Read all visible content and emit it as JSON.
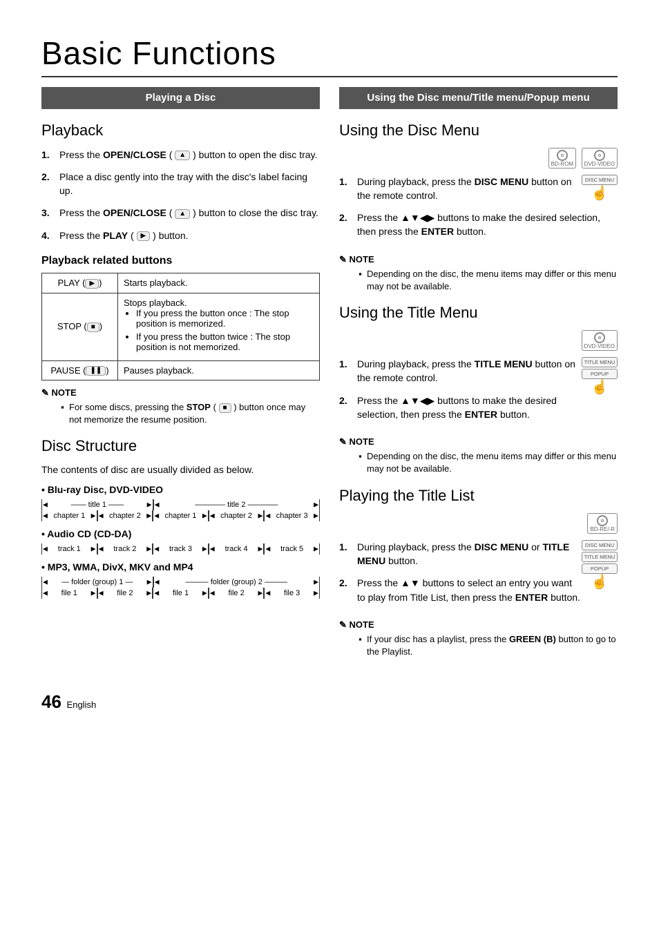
{
  "page": {
    "title": "Basic Functions",
    "number": "46",
    "lang": "English"
  },
  "left": {
    "band": "Playing a Disc",
    "playback_head": "Playback",
    "steps": [
      {
        "pre": "Press the ",
        "bold": "OPEN/CLOSE",
        "post_icon": "▲",
        "tail": " button to open the disc tray."
      },
      {
        "pre": "Place a disc gently into the tray with the disc's label facing up.",
        "bold": "",
        "post_icon": "",
        "tail": ""
      },
      {
        "pre": "Press the ",
        "bold": "OPEN/CLOSE",
        "post_icon": "▲",
        "tail": " button to close the disc tray."
      },
      {
        "pre": "Press the ",
        "bold": "PLAY",
        "post_icon": "▶",
        "tail": " button."
      }
    ],
    "related_head": "Playback related buttons",
    "table": [
      {
        "name": "PLAY",
        "icon": "▶",
        "desc": "Starts playback.",
        "bullets": []
      },
      {
        "name": "STOP",
        "icon": "■",
        "desc": "Stops playback.",
        "bullets": [
          "If you press the button once : The stop position is memorized.",
          "If you press the button twice : The stop position is not memorized."
        ]
      },
      {
        "name": "PAUSE",
        "icon": "❚❚",
        "desc": "Pauses playback.",
        "bullets": []
      }
    ],
    "note_label": "NOTE",
    "note_items": [
      {
        "pre": "For some discs, pressing the ",
        "bold": "STOP",
        "icon": "■",
        "tail": " button once may not memorize the resume position."
      }
    ],
    "structure_head": "Disc Structure",
    "structure_intro": "The contents of disc are usually divided as below.",
    "structs": [
      {
        "label": "• Blu-ray Disc, DVD-VIDEO",
        "rows": [
          [
            "title 1",
            "title 2"
          ],
          [
            "chapter 1",
            "chapter 2",
            "chapter 1",
            "chapter 2",
            "chapter 3"
          ]
        ]
      },
      {
        "label": "• Audio CD (CD-DA)",
        "rows": [
          [
            "track 1",
            "track 2",
            "track 3",
            "track 4",
            "track 5"
          ]
        ]
      },
      {
        "label": "• MP3, WMA, DivX, MKV and MP4",
        "rows": [
          [
            "folder (group) 1",
            "folder (group) 2"
          ],
          [
            "file 1",
            "file 2",
            "file 1",
            "file 2",
            "file 3"
          ]
        ]
      }
    ]
  },
  "right": {
    "band": "Using the Disc menu/Title menu/Popup menu",
    "sections": [
      {
        "head": "Using the Disc Menu",
        "badges": [
          "BD-ROM",
          "DVD-VIDEO"
        ],
        "side": {
          "buttons": [
            "DISC MENU"
          ],
          "hand": "☝"
        },
        "steps": [
          {
            "pre": "During playback, press the ",
            "bold": "DISC MENU",
            "tail": " button on the remote control."
          },
          {
            "pre": "Press the ▲▼◀▶ buttons to make the desired selection, then press the ",
            "bold": "ENTER",
            "tail": " button."
          }
        ],
        "note_label": "NOTE",
        "notes": [
          "Depending on the disc, the menu items may differ or this menu may not be available."
        ]
      },
      {
        "head": "Using the Title Menu",
        "badges": [
          "DVD-VIDEO"
        ],
        "side": {
          "buttons": [
            "TITLE MENU",
            "POPUP"
          ],
          "hand": "☝"
        },
        "steps": [
          {
            "pre": "During playback, press the ",
            "bold": "TITLE MENU",
            "tail": " button on the remote control."
          },
          {
            "pre": "Press the ▲▼◀▶ buttons to make the desired selection, then press the ",
            "bold": "ENTER",
            "tail": " button."
          }
        ],
        "note_label": "NOTE",
        "notes": [
          "Depending on the disc, the menu items may differ or this menu may not be available."
        ]
      },
      {
        "head": "Playing the Title List",
        "badges": [
          "BD-RE/-R"
        ],
        "side": {
          "buttons": [
            "DISC MENU",
            "TITLE MENU",
            "POPUP"
          ],
          "hand": "☝"
        },
        "steps": [
          {
            "pre": "During playback, press the ",
            "bold": "DISC MENU",
            "mid": " or ",
            "bold2": "TITLE MENU",
            "tail": " button."
          },
          {
            "pre": "Press the ▲▼ buttons to select an entry you want to play from Title List, then press the ",
            "bold": "ENTER",
            "tail": " button."
          }
        ],
        "note_label": "NOTE",
        "notes_rich": [
          {
            "pre": "If your disc has a playlist, press the ",
            "bold": "GREEN (B)",
            "tail": " button to go to the Playlist."
          }
        ]
      }
    ]
  }
}
